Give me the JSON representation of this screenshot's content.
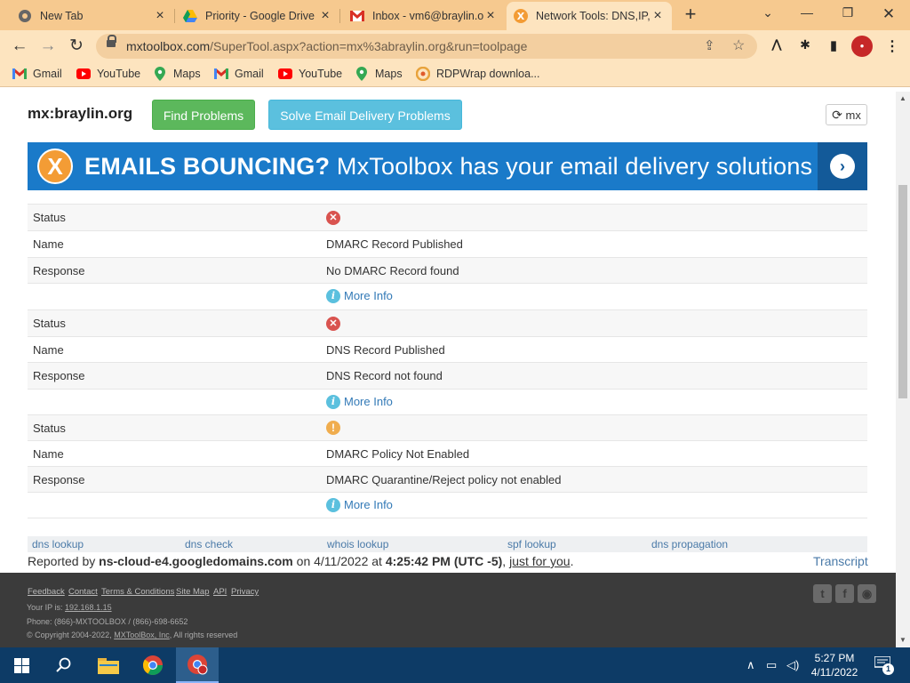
{
  "browser": {
    "tabs": [
      {
        "title": "New Tab",
        "active": false
      },
      {
        "title": "Priority - Google Drive",
        "active": false
      },
      {
        "title": "Inbox - vm6@braylin.o",
        "active": false
      },
      {
        "title": "Network Tools: DNS,IP,",
        "active": true
      }
    ],
    "url_host": "mxtoolbox.com",
    "url_path": "/SuperTool.aspx?action=mx%3abraylin.org&run=toolpage",
    "bookmarks": [
      "Gmail",
      "YouTube",
      "Maps",
      "Gmail",
      "YouTube",
      "Maps",
      "RDPWrap downloa..."
    ]
  },
  "page": {
    "domain_heading": "mx:braylin.org",
    "find_problems_label": "Find Problems",
    "solve_label": "Solve Email Delivery Problems",
    "refresh_label": "mx",
    "banner": {
      "bold": "EMAILS BOUNCING?",
      "rest": " MxToolbox has your email delivery solutions"
    },
    "labels": {
      "status": "Status",
      "name": "Name",
      "response": "Response",
      "more_info": "More Info"
    },
    "results": [
      {
        "status": "error",
        "name": "DMARC Record Published",
        "response": "No DMARC Record found"
      },
      {
        "status": "error",
        "name": "DNS Record Published",
        "response": "DNS Record not found"
      },
      {
        "status": "warning",
        "name": "DMARC Policy Not Enabled",
        "response": "DMARC Quarantine/Reject policy not enabled"
      }
    ],
    "quick_links": [
      "dns lookup",
      "dns check",
      "whois lookup",
      "spf lookup",
      "dns propagation"
    ],
    "reported": {
      "prefix": "Reported by ",
      "server": "ns-cloud-e4.googledomains.com",
      "on": " on 4/11/2022 at ",
      "time": "4:25:42 PM (UTC -5)",
      "sep": ", ",
      "link": "just for you",
      "end": "."
    },
    "transcript_label": "Transcript"
  },
  "footer": {
    "links": [
      "Feedback",
      "Contact",
      "Terms & Conditions",
      "Site Map",
      "API",
      "Privacy"
    ],
    "ip_prefix": "Your IP is: ",
    "ip": "192.168.1.15",
    "phone": "Phone: (866)-MXTOOLBOX / (866)-698-6652",
    "copyright_prefix": "© Copyright 2004-2022, ",
    "copyright_company": "MXToolBox, Inc",
    "copyright_suffix": ", All rights reserved"
  },
  "taskbar": {
    "time": "5:27 PM",
    "date": "4/11/2022",
    "notification_count": "1"
  },
  "colors": {
    "find_button": "#5cb85c",
    "solve_button": "#5bc0de",
    "banner": "#1a7ac9",
    "error": "#d9534f",
    "warning": "#f0ad4e"
  }
}
